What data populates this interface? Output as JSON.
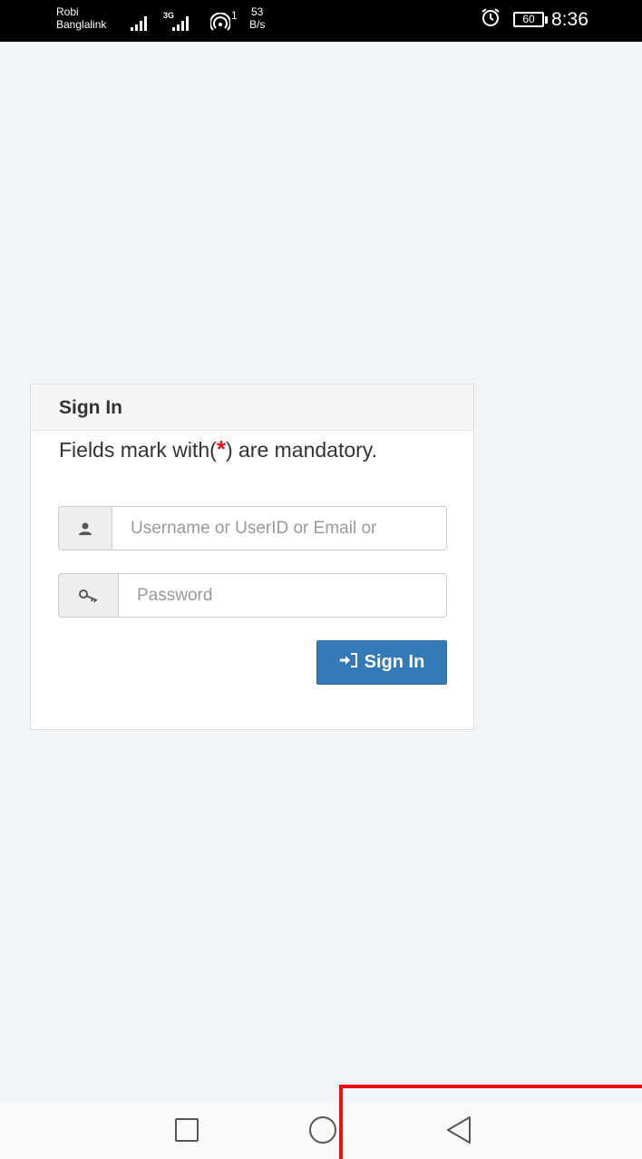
{
  "status_bar": {
    "carrier_line1": "Robi",
    "carrier_line2": "Banglalink",
    "network_type": "3G",
    "hotspot_count": "1",
    "speed_value": "53",
    "speed_unit": "B/s",
    "battery": "60",
    "time": "8:36",
    "icons": [
      "signal-icon",
      "signal-icon",
      "hotspot-icon",
      "alarm-icon",
      "battery-icon"
    ]
  },
  "signin": {
    "title": "Sign In",
    "mandatory_prefix": "Fields mark with(",
    "mandatory_star": "*",
    "mandatory_suffix": ") are mandatory.",
    "username_placeholder": "Username or UserID or Email or",
    "password_placeholder": "Password",
    "button_label": "Sign In",
    "button_color": "#337ab7"
  },
  "nav": {
    "icons": [
      "recent-apps-icon",
      "home-icon",
      "back-icon"
    ]
  }
}
